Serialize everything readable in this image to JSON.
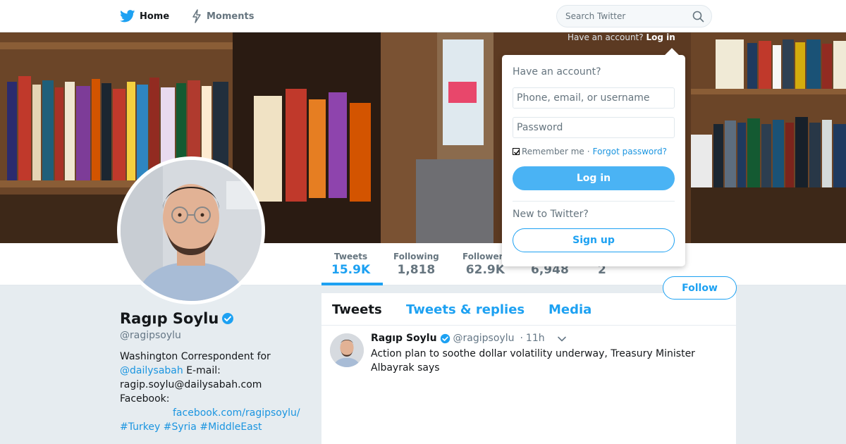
{
  "nav": {
    "home_label": "Home",
    "moments_label": "Moments",
    "search_placeholder": "Search Twitter",
    "have_account_text": "Have an account?",
    "login_link": "Log in",
    "brand_color": "#1da1f2"
  },
  "login_dropdown": {
    "heading": "Have an account?",
    "username_placeholder": "Phone, email, or username",
    "password_placeholder": "Password",
    "remember_label": "Remember me",
    "separator": "·",
    "forgot_link": "Forgot password?",
    "login_button": "Log in",
    "new_prompt": "New to Twitter?",
    "signup_button": "Sign up"
  },
  "stats": [
    {
      "label": "Tweets",
      "value": "15.9K",
      "active": true
    },
    {
      "label": "Following",
      "value": "1,818"
    },
    {
      "label": "Followers",
      "value": "62.9K"
    },
    {
      "label": "",
      "value": "6,948"
    },
    {
      "label": "",
      "value": "2"
    }
  ],
  "profile": {
    "name": "Ragıp Soylu",
    "handle": "@ragipsoylu",
    "bio_line1": "Washington Correspondent for",
    "bio_mention": "@dailysabah",
    "bio_email_label": " E-mail:",
    "bio_email": "ragip.soylu@dailysabah.com",
    "bio_facebook_label": "Facebook:",
    "bio_facebook_link": "facebook.com/ragipsoylu/",
    "hashtags": [
      "#Turkey",
      "#Syria",
      "#MiddleEast"
    ],
    "follow_button": "Follow"
  },
  "timeline": {
    "tabs": [
      "Tweets",
      "Tweets & replies",
      "Media"
    ],
    "tweet": {
      "name": "Ragıp Soylu",
      "handle": "@ragipsoylu",
      "separator": "·",
      "time": "11h",
      "text": "Action plan to soothe dollar volatility underway, Treasury Minister Albayrak says"
    }
  }
}
